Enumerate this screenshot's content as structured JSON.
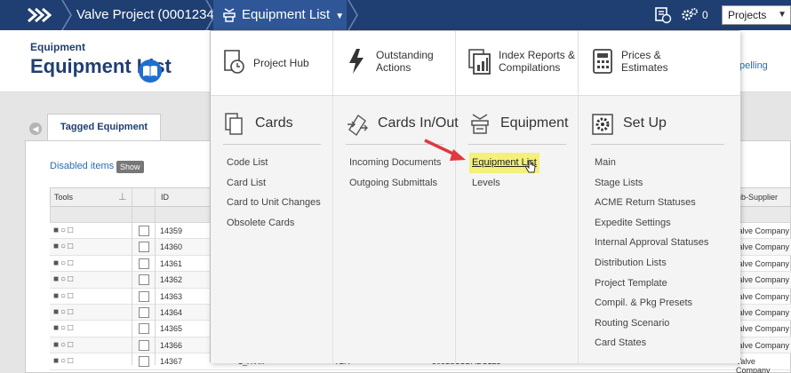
{
  "topbar": {
    "project": "Valve Project (0001234)",
    "active_page": "Equipment List",
    "notification_count": "0",
    "projects_select": "Projects"
  },
  "header": {
    "section": "Equipment",
    "title": "Equipment List",
    "spelling_link": "pelling"
  },
  "tab": {
    "label": "Tagged Equipment Units"
  },
  "disabled_items": {
    "label": "Disabled items",
    "button": "Show"
  },
  "table": {
    "headers": {
      "tools": "Tools",
      "id": "ID",
      "sub_supplier": "ub-Supplier"
    },
    "rows": [
      {
        "id": "14359",
        "c1": "",
        "c2": "",
        "c3": "",
        "sup": "/alve Company"
      },
      {
        "id": "14360",
        "c1": "",
        "c2": "",
        "c3": "",
        "sup": "/alve Company"
      },
      {
        "id": "14361",
        "c1": "",
        "c2": "",
        "c3": "",
        "sup": "/alve Company"
      },
      {
        "id": "14362",
        "c1": "",
        "c2": "",
        "c3": "",
        "sup": "/alve Company"
      },
      {
        "id": "14363",
        "c1": "",
        "c2": "",
        "c3": "",
        "sup": "/alve Company"
      },
      {
        "id": "14364",
        "c1": "",
        "c2": "",
        "c3": "",
        "sup": "/alve Company"
      },
      {
        "id": "14365",
        "c1": "",
        "c2": "",
        "c3": "",
        "sup": "/alve Company"
      },
      {
        "id": "14366",
        "c1": "",
        "c2": "",
        "c3": "",
        "sup": "/alve Company"
      },
      {
        "id": "14367",
        "c1": "1_XVIII",
        "c2": "TBA",
        "c3": "3051S1CDABC123",
        "sup": "Valve Company"
      }
    ]
  },
  "menu": {
    "tiles": {
      "project_hub": "Project Hub",
      "outstanding_1": "Outstanding",
      "outstanding_2": "Actions",
      "index_1": "Index Reports &",
      "index_2": "Compilations",
      "prices_1": "Prices &",
      "prices_2": "Estimates"
    },
    "columns": {
      "cards": {
        "title": "Cards",
        "items": [
          "Code List",
          "Card List",
          "Card to Unit Changes",
          "Obsolete Cards"
        ]
      },
      "cards_in_out": {
        "title": "Cards In/Out",
        "items": [
          "Incoming Documents",
          "Outgoing Submittals"
        ]
      },
      "equipment": {
        "title": "Equipment",
        "items": [
          "Equipment List",
          "Levels"
        ]
      },
      "setup": {
        "title": "Set Up",
        "items": [
          "Main",
          "Stage Lists",
          "ACME Return Statuses",
          "Expedite Settings",
          "Internal Approval Statuses",
          "Distribution Lists",
          "Project Template",
          "Compil. & Pkg Presets",
          "Routing Scenario",
          "Card States"
        ]
      }
    }
  },
  "colors": {
    "topbar": "#1f3f72",
    "highlight": "#f4f07a",
    "arrow": "#e0383e"
  }
}
